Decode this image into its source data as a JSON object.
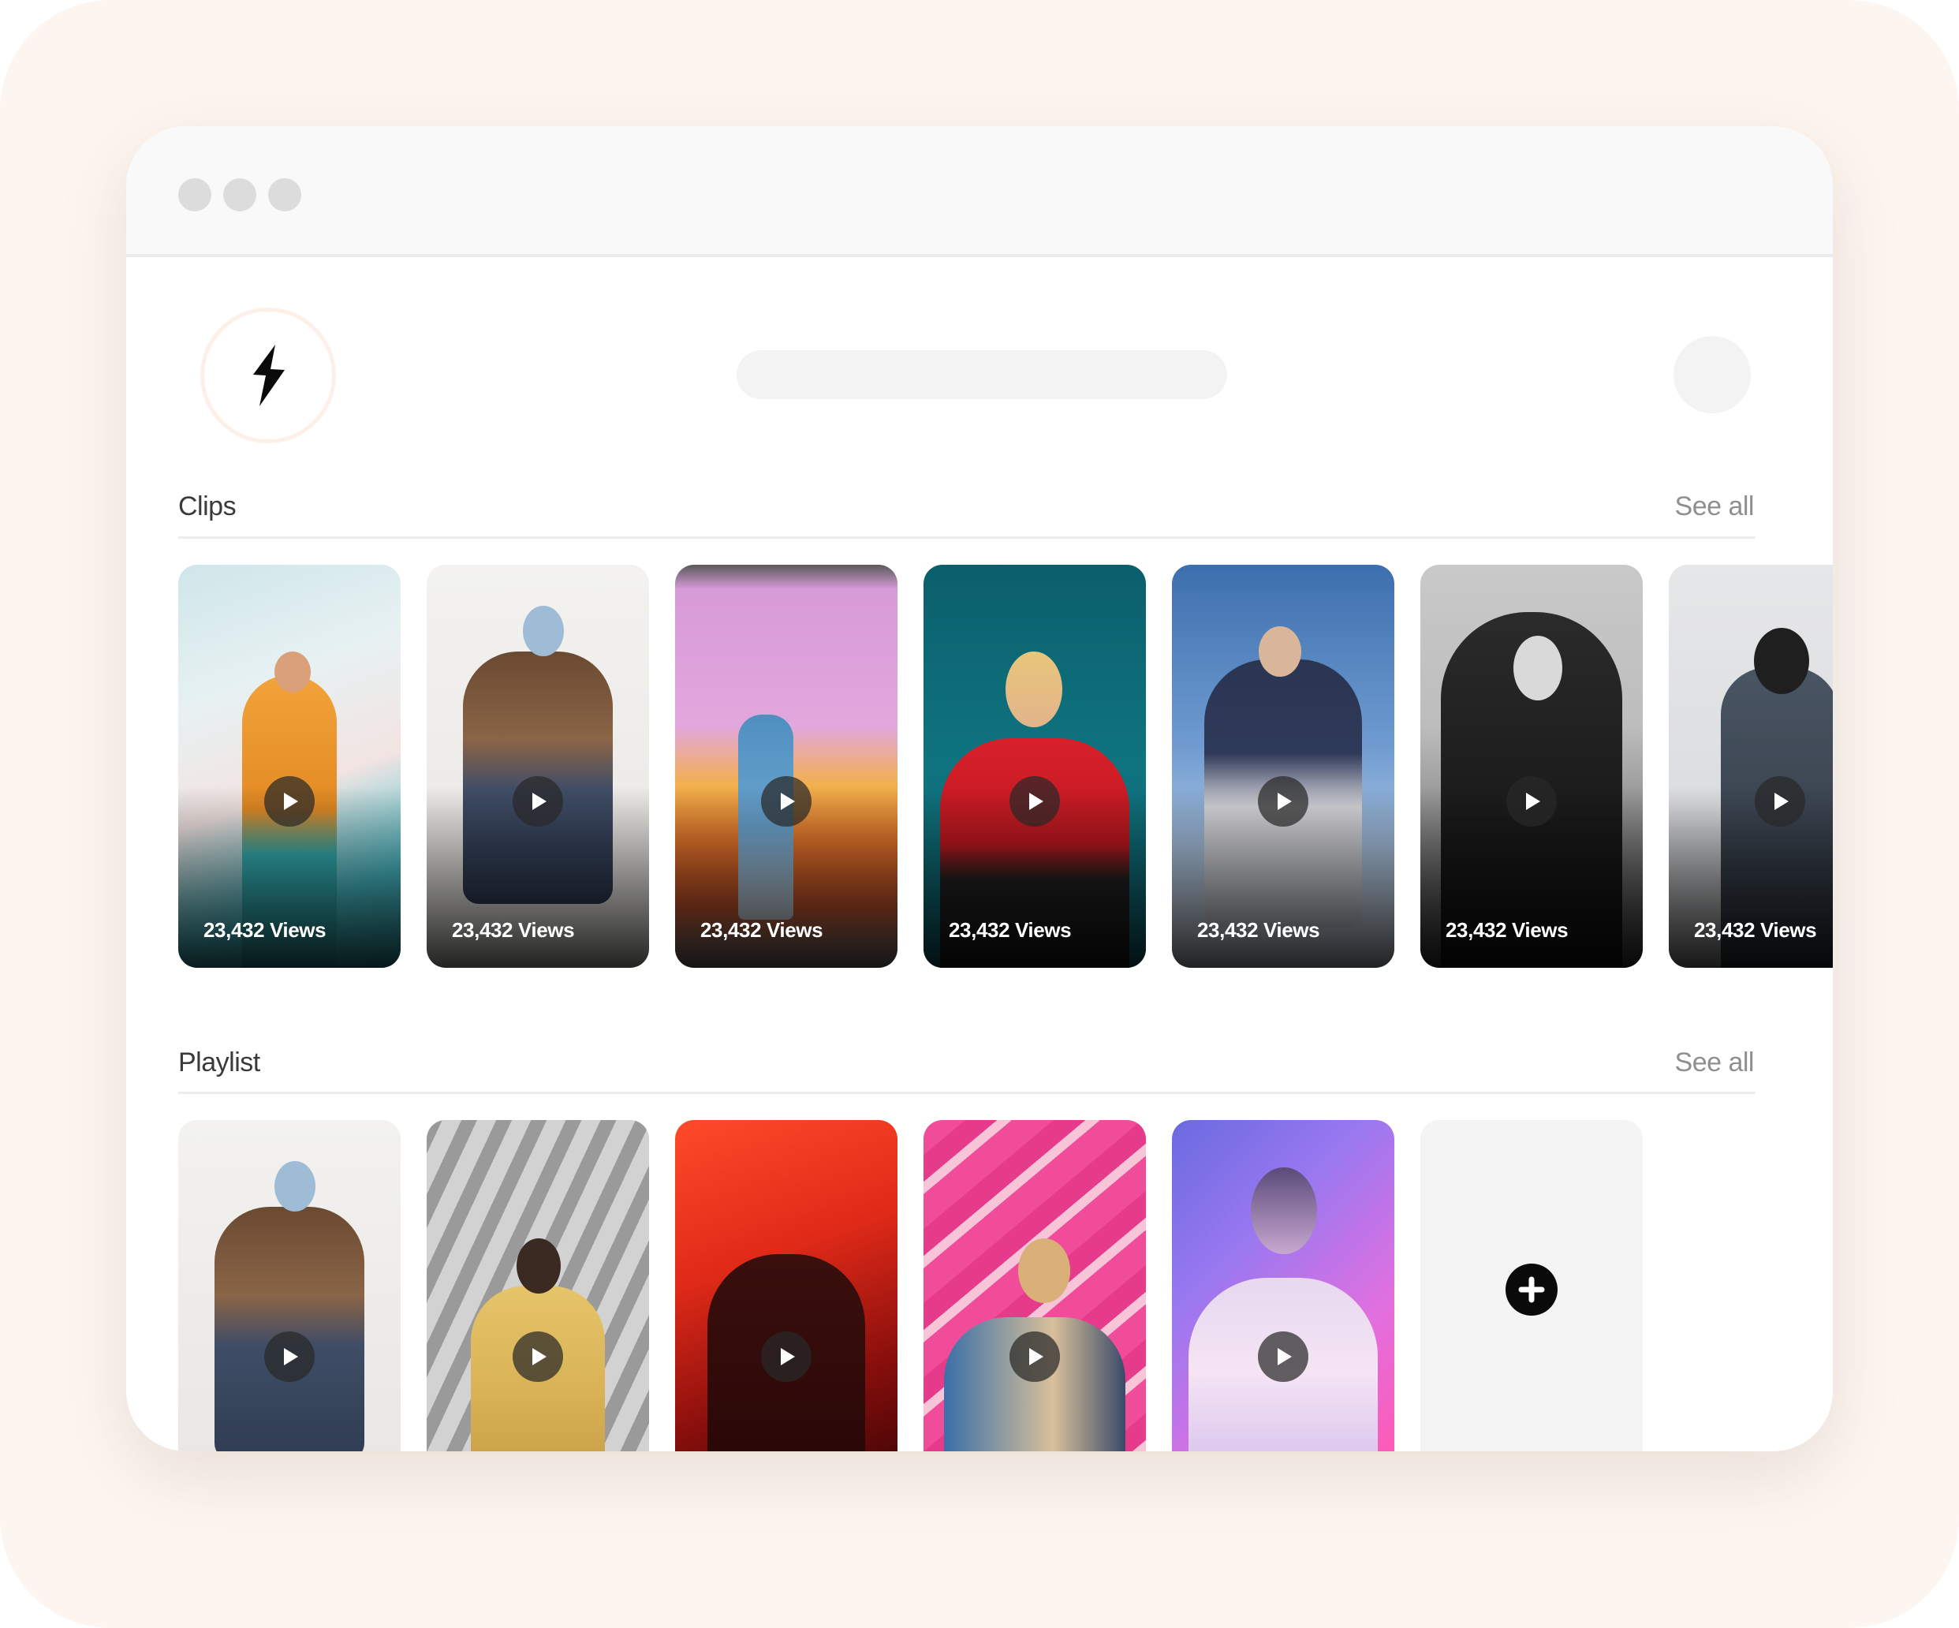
{
  "header": {
    "search": {
      "placeholder": ""
    }
  },
  "clips": {
    "title": "Clips",
    "see_all": "See all",
    "items": [
      {
        "views": "23,432 Views"
      },
      {
        "views": "23,432 Views"
      },
      {
        "views": "23,432 Views"
      },
      {
        "views": "23,432 Views"
      },
      {
        "views": "23,432 Views"
      },
      {
        "views": "23,432 Views"
      },
      {
        "views": "23,432 Views"
      }
    ]
  },
  "playlist": {
    "title": "Playlist",
    "see_all": "See all"
  },
  "icons": {
    "logo": "lightning-bolt-icon",
    "play": "play-icon",
    "add": "plus-circle-icon"
  },
  "colors": {
    "page_background": "#fdf5f0",
    "window_background": "#ffffff",
    "titlebar": "#f9f9f9",
    "add_button": "#0a0a0a"
  }
}
